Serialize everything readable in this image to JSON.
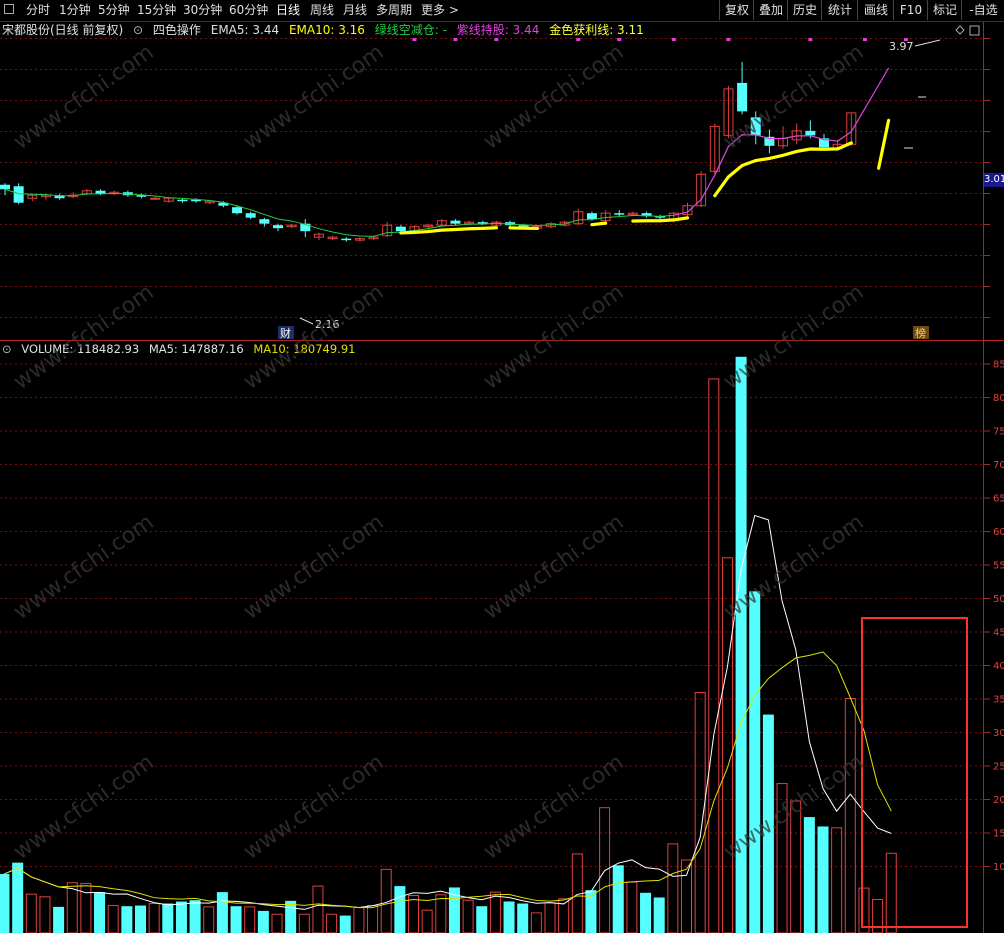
{
  "toolbar": {
    "periods": [
      "分时",
      "1分钟",
      "5分钟",
      "15分钟",
      "30分钟",
      "60分钟",
      "日线",
      "周线",
      "月线",
      "多周期",
      "更多 >"
    ],
    "right_buttons": [
      "复权",
      "叠加",
      "历史",
      "统计",
      "画线",
      "F10",
      "标记",
      "-自选"
    ]
  },
  "info": {
    "stock": "宋都股份(日线 前复权)",
    "indicator": "四色操作",
    "ema5": "EMA5: 3.44",
    "ema10": "EMA10: 3.16",
    "green_line": "绿线空减仓: -",
    "purple_line": "紫线持股: 3.44",
    "gold_line": "金色获利线: 3.11"
  },
  "price_panel": {
    "high_label": "3.97",
    "low_label": "2.16",
    "current_price_tag": "3.01",
    "cai_badge": "财",
    "bang_badge": "榜"
  },
  "volume": {
    "label": "VOLUME: 118482.93",
    "ma5": "MA5: 147887.16",
    "ma10": "MA10: 180749.91",
    "yaxis": [
      "85",
      "80",
      "75",
      "70",
      "65",
      "60",
      "55",
      "50",
      "45",
      "40",
      "35",
      "30",
      "25",
      "20",
      "15",
      "10"
    ]
  },
  "watermark": "www.cfchi.com",
  "colors": {
    "up": "#e24040",
    "down": "#55ffff",
    "gold": "#ffff00",
    "purple": "#e040e0",
    "green": "#22cc44",
    "ma5": "#ffffff",
    "ma10": "#e0e000",
    "highlight": "#ff3030"
  },
  "volume_bars": [
    {
      "v": 8.8,
      "up": false
    },
    {
      "v": 10.5,
      "up": false
    },
    {
      "v": 5.8,
      "up": true
    },
    {
      "v": 5.4,
      "up": true
    },
    {
      "v": 3.9,
      "up": false
    },
    {
      "v": 7.5,
      "up": true
    },
    {
      "v": 7.4,
      "up": true
    },
    {
      "v": 6.1,
      "up": false
    },
    {
      "v": 4.1,
      "up": true
    },
    {
      "v": 4.0,
      "up": false
    },
    {
      "v": 4.1,
      "up": false
    },
    {
      "v": 4.4,
      "up": true
    },
    {
      "v": 4.4,
      "up": false
    },
    {
      "v": 4.7,
      "up": false
    },
    {
      "v": 4.9,
      "up": false
    },
    {
      "v": 3.9,
      "up": true
    },
    {
      "v": 6.1,
      "up": false
    },
    {
      "v": 4.0,
      "up": false
    },
    {
      "v": 3.9,
      "up": true
    },
    {
      "v": 3.3,
      "up": false
    },
    {
      "v": 2.8,
      "up": true
    },
    {
      "v": 4.8,
      "up": false
    },
    {
      "v": 2.8,
      "up": true
    },
    {
      "v": 7.0,
      "up": true
    },
    {
      "v": 2.8,
      "up": true
    },
    {
      "v": 2.6,
      "up": false
    },
    {
      "v": 3.8,
      "up": true
    },
    {
      "v": 4.1,
      "up": true
    },
    {
      "v": 9.5,
      "up": true
    },
    {
      "v": 7.0,
      "up": false
    },
    {
      "v": 5.6,
      "up": true
    },
    {
      "v": 3.4,
      "up": true
    },
    {
      "v": 5.7,
      "up": true
    },
    {
      "v": 6.8,
      "up": false
    },
    {
      "v": 4.9,
      "up": true
    },
    {
      "v": 4.0,
      "up": false
    },
    {
      "v": 6.1,
      "up": true
    },
    {
      "v": 4.7,
      "up": false
    },
    {
      "v": 4.4,
      "up": false
    },
    {
      "v": 3.0,
      "up": true
    },
    {
      "v": 4.5,
      "up": true
    },
    {
      "v": 5.1,
      "up": true
    },
    {
      "v": 11.8,
      "up": true
    },
    {
      "v": 6.4,
      "up": false
    },
    {
      "v": 18.7,
      "up": true
    },
    {
      "v": 10.1,
      "up": false
    },
    {
      "v": 7.6,
      "up": true
    },
    {
      "v": 6.0,
      "up": false
    },
    {
      "v": 5.3,
      "up": false
    },
    {
      "v": 13.3,
      "up": true
    },
    {
      "v": 10.9,
      "up": true
    },
    {
      "v": 35.9,
      "up": true
    },
    {
      "v": 82.7,
      "up": true
    },
    {
      "v": 56.0,
      "up": true
    },
    {
      "v": 86.0,
      "up": false
    },
    {
      "v": 51.0,
      "up": false
    },
    {
      "v": 32.6,
      "up": false
    },
    {
      "v": 22.3,
      "up": true
    },
    {
      "v": 19.7,
      "up": true
    },
    {
      "v": 17.3,
      "up": false
    },
    {
      "v": 15.9,
      "up": false
    },
    {
      "v": 15.7,
      "up": true
    },
    {
      "v": 35.0,
      "up": true
    },
    {
      "v": 6.7,
      "up": true
    },
    {
      "v": 5.0,
      "up": true
    },
    {
      "v": 11.9,
      "up": true
    }
  ],
  "candles": [
    [
      3.07,
      3.04,
      3.08,
      3.0,
      false
    ],
    [
      3.06,
      2.95,
      3.08,
      2.94,
      false
    ],
    [
      2.98,
      3.0,
      3.01,
      2.96,
      true
    ],
    [
      2.99,
      3.0,
      3.01,
      2.97,
      true
    ],
    [
      3.0,
      2.98,
      3.01,
      2.97,
      false
    ],
    [
      2.99,
      3.0,
      3.02,
      2.98,
      true
    ],
    [
      3.01,
      3.03,
      3.04,
      3.0,
      true
    ],
    [
      3.03,
      3.01,
      3.04,
      3.0,
      false
    ],
    [
      3.01,
      3.02,
      3.03,
      3.0,
      true
    ],
    [
      3.02,
      3.0,
      3.03,
      2.99,
      false
    ],
    [
      3.0,
      2.99,
      3.01,
      2.98,
      false
    ],
    [
      2.98,
      2.98,
      2.99,
      2.97,
      true
    ],
    [
      2.98,
      2.96,
      2.99,
      2.95,
      true
    ],
    [
      2.96,
      2.97,
      2.98,
      2.95,
      false
    ],
    [
      2.97,
      2.96,
      2.98,
      2.95,
      false
    ],
    [
      2.96,
      2.95,
      2.97,
      2.94,
      true
    ],
    [
      2.95,
      2.93,
      2.96,
      2.92,
      false
    ],
    [
      2.92,
      2.88,
      2.93,
      2.87,
      false
    ],
    [
      2.88,
      2.85,
      2.89,
      2.84,
      false
    ],
    [
      2.84,
      2.81,
      2.85,
      2.79,
      false
    ],
    [
      2.8,
      2.78,
      2.81,
      2.76,
      false
    ],
    [
      2.79,
      2.8,
      2.81,
      2.78,
      true
    ],
    [
      2.81,
      2.76,
      2.84,
      2.72,
      false
    ],
    [
      2.74,
      2.72,
      2.75,
      2.7,
      true
    ],
    [
      2.72,
      2.71,
      2.73,
      2.7,
      true
    ],
    [
      2.71,
      2.7,
      2.72,
      2.69,
      false
    ],
    [
      2.7,
      2.71,
      2.72,
      2.69,
      true
    ],
    [
      2.71,
      2.72,
      2.73,
      2.7,
      true
    ],
    [
      2.73,
      2.8,
      2.82,
      2.72,
      true
    ],
    [
      2.79,
      2.76,
      2.8,
      2.74,
      false
    ],
    [
      2.76,
      2.79,
      2.8,
      2.75,
      true
    ],
    [
      2.79,
      2.8,
      2.81,
      2.77,
      true
    ],
    [
      2.8,
      2.83,
      2.84,
      2.79,
      true
    ],
    [
      2.83,
      2.81,
      2.84,
      2.8,
      false
    ],
    [
      2.81,
      2.82,
      2.83,
      2.8,
      true
    ],
    [
      2.82,
      2.81,
      2.83,
      2.8,
      false
    ],
    [
      2.8,
      2.82,
      2.83,
      2.79,
      true
    ],
    [
      2.82,
      2.8,
      2.83,
      2.79,
      false
    ],
    [
      2.8,
      2.79,
      2.81,
      2.78,
      false
    ],
    [
      2.78,
      2.79,
      2.8,
      2.77,
      true
    ],
    [
      2.79,
      2.81,
      2.82,
      2.78,
      true
    ],
    [
      2.8,
      2.82,
      2.83,
      2.79,
      true
    ],
    [
      2.81,
      2.89,
      2.91,
      2.8,
      true
    ],
    [
      2.88,
      2.84,
      2.89,
      2.83,
      false
    ],
    [
      2.83,
      2.88,
      2.9,
      2.82,
      true
    ],
    [
      2.88,
      2.87,
      2.9,
      2.86,
      false
    ],
    [
      2.87,
      2.88,
      2.89,
      2.86,
      true
    ],
    [
      2.88,
      2.86,
      2.89,
      2.85,
      false
    ],
    [
      2.86,
      2.85,
      2.87,
      2.84,
      false
    ],
    [
      2.83,
      2.88,
      2.89,
      2.82,
      true
    ],
    [
      2.87,
      2.93,
      2.95,
      2.86,
      true
    ],
    [
      2.93,
      3.14,
      3.16,
      2.92,
      true
    ],
    [
      3.16,
      3.46,
      3.48,
      3.14,
      true
    ],
    [
      3.4,
      3.71,
      3.73,
      3.38,
      true
    ],
    [
      3.75,
      3.56,
      3.89,
      3.54,
      false
    ],
    [
      3.52,
      3.4,
      3.56,
      3.34,
      false
    ],
    [
      3.39,
      3.33,
      3.44,
      3.28,
      false
    ],
    [
      3.33,
      3.38,
      3.46,
      3.31,
      true
    ],
    [
      3.37,
      3.43,
      3.48,
      3.34,
      true
    ],
    [
      3.43,
      3.4,
      3.5,
      3.38,
      false
    ],
    [
      3.38,
      3.32,
      3.41,
      3.3,
      false
    ],
    [
      3.31,
      3.34,
      3.37,
      3.3,
      true
    ],
    [
      3.34,
      3.55,
      3.55,
      3.33,
      true
    ]
  ]
}
